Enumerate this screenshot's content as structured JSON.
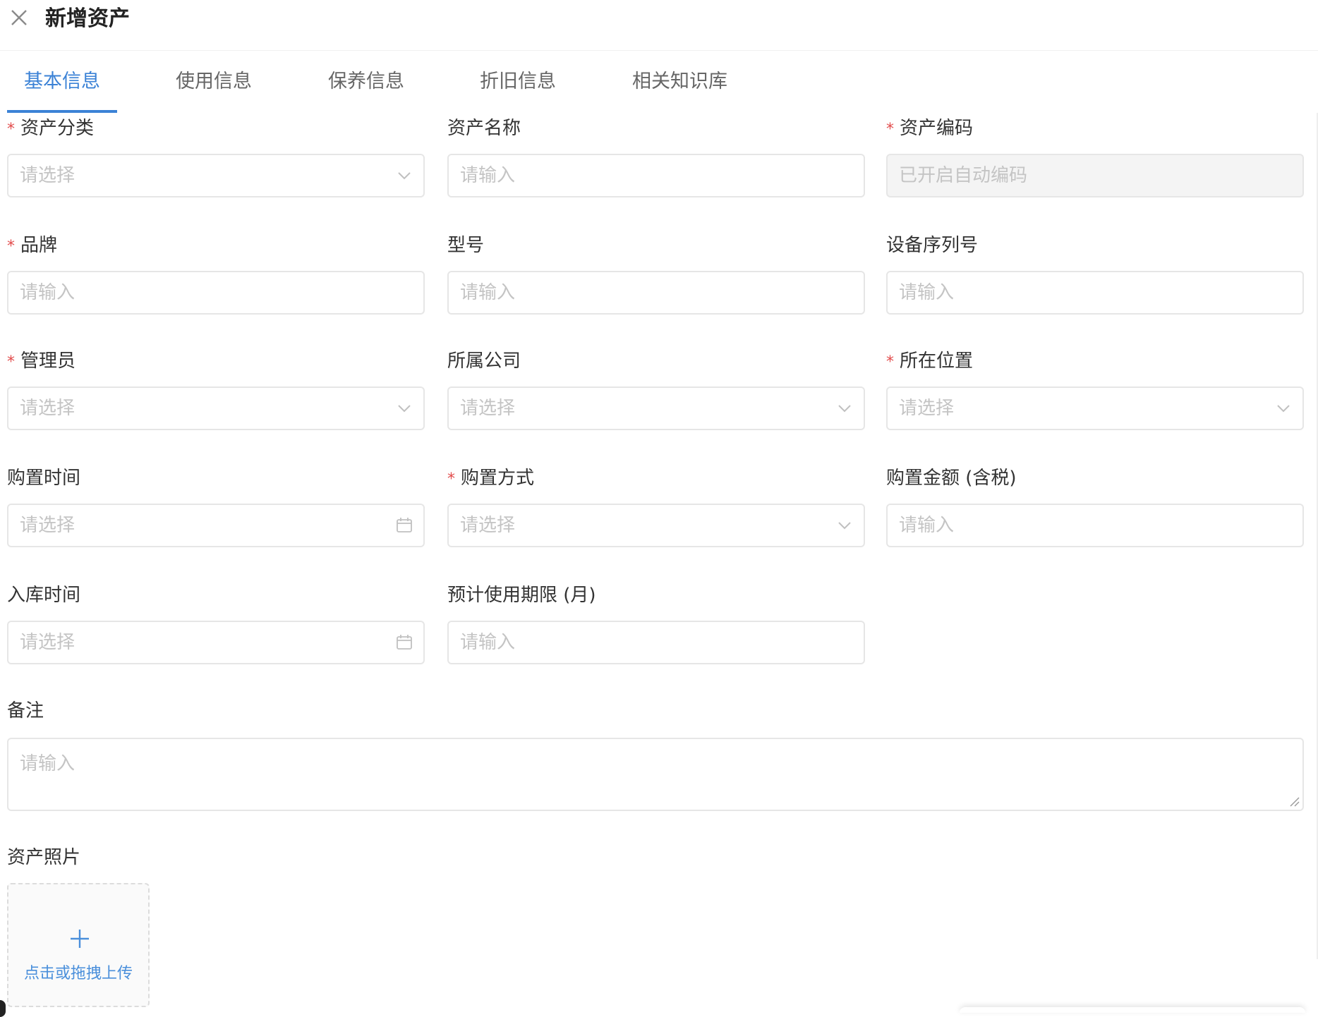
{
  "header": {
    "title": "新增资产",
    "close_icon": "close-icon"
  },
  "tabs": [
    {
      "label": "基本信息",
      "active": true
    },
    {
      "label": "使用信息",
      "active": false
    },
    {
      "label": "保养信息",
      "active": false
    },
    {
      "label": "折旧信息",
      "active": false
    },
    {
      "label": "相关知识库",
      "active": false
    }
  ],
  "colors": {
    "accent": "#3b82d6",
    "required": "#e24c4c",
    "placeholder": "#c4c4c4",
    "border": "#e6e6e6"
  },
  "form": {
    "required_mark": "*",
    "fields": {
      "category": {
        "label": "资产分类",
        "placeholder": "请选择",
        "required": true,
        "type": "select"
      },
      "name": {
        "label": "资产名称",
        "placeholder": "请输入",
        "required": false,
        "type": "input"
      },
      "code": {
        "label": "资产编码",
        "placeholder": "已开启自动编码",
        "required": true,
        "type": "disabled"
      },
      "brand": {
        "label": "品牌",
        "placeholder": "请输入",
        "required": true,
        "type": "input"
      },
      "model": {
        "label": "型号",
        "placeholder": "请输入",
        "required": false,
        "type": "input"
      },
      "serial": {
        "label": "设备序列号",
        "placeholder": "请输入",
        "required": false,
        "type": "input"
      },
      "admin": {
        "label": "管理员",
        "placeholder": "请选择",
        "required": true,
        "type": "select"
      },
      "company": {
        "label": "所属公司",
        "placeholder": "请选择",
        "required": false,
        "type": "select"
      },
      "location": {
        "label": "所在位置",
        "placeholder": "请选择",
        "required": true,
        "type": "select"
      },
      "purchase_time": {
        "label": "购置时间",
        "placeholder": "请选择",
        "required": false,
        "type": "date"
      },
      "purchase_method": {
        "label": "购置方式",
        "placeholder": "请选择",
        "required": true,
        "type": "select"
      },
      "purchase_amount": {
        "label": "购置金额 (含税)",
        "placeholder": "请输入",
        "required": false,
        "type": "input"
      },
      "storage_time": {
        "label": "入库时间",
        "placeholder": "请选择",
        "required": false,
        "type": "date"
      },
      "usage_period": {
        "label": "预计使用期限 (月)",
        "placeholder": "请输入",
        "required": false,
        "type": "input"
      },
      "remark": {
        "label": "备注",
        "placeholder": "请输入",
        "required": false,
        "type": "textarea"
      },
      "photo": {
        "label": "资产照片",
        "upload_text": "点击或拖拽上传",
        "upload_icon": "plus-icon"
      }
    }
  }
}
